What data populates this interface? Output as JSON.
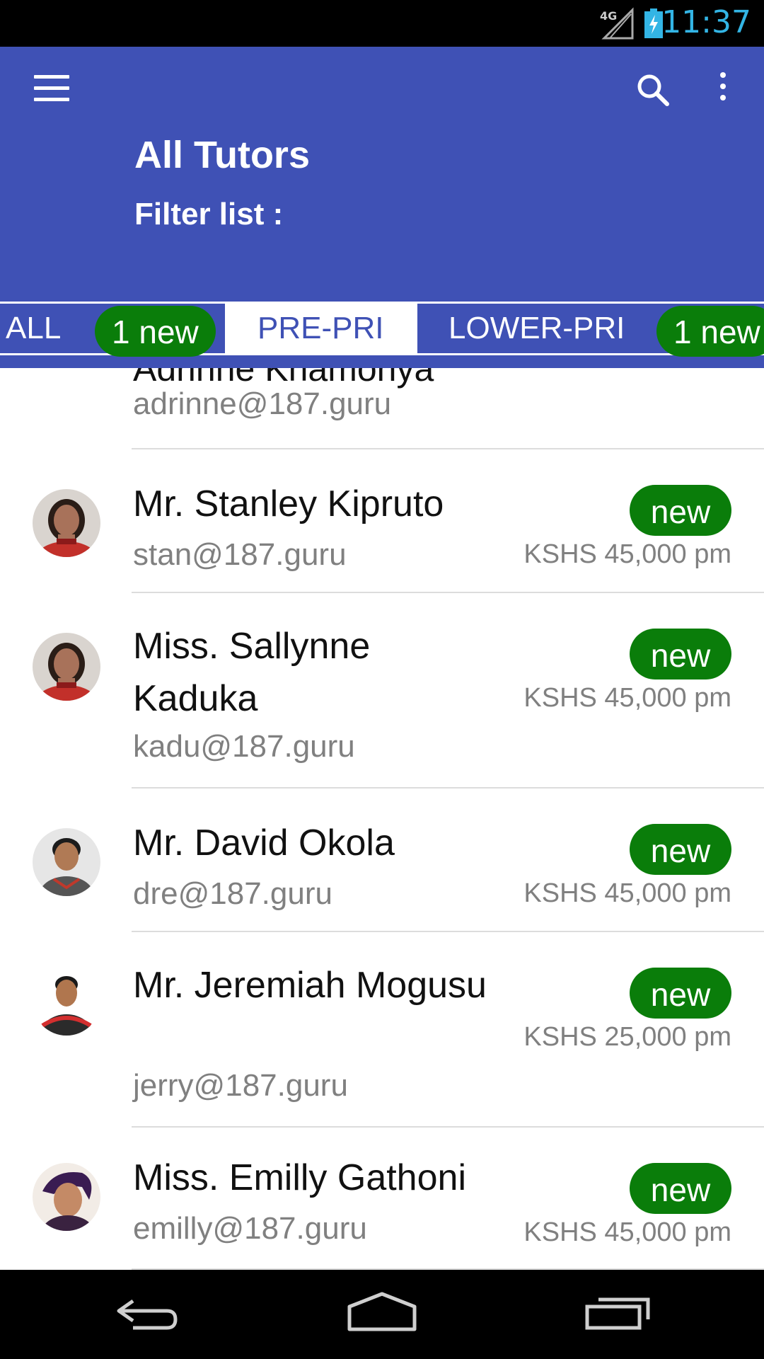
{
  "status_bar": {
    "network": "4G",
    "time": "11:37",
    "clock_color": "#33b5e5"
  },
  "app_bar": {
    "title": "All Tutors",
    "filter_label": "Filter list :",
    "background": "#3f51b5"
  },
  "tabs": [
    {
      "label": "ALL",
      "badge": "1 new",
      "active": false
    },
    {
      "label": "PRE-PRI",
      "badge": "",
      "active": true
    },
    {
      "label": "LOWER-PRI",
      "badge": "1 new",
      "active": false
    }
  ],
  "partial_row": {
    "name": "Adrinne Khamonya",
    "email": "adrinne@187.guru"
  },
  "tutors": [
    {
      "name": "Mr. Stanley Kipruto",
      "email": "stan@187.guru",
      "badge": "new",
      "price": "KSHS 45,000 pm"
    },
    {
      "name": "Miss. Sallynne Kaduka",
      "email": "kadu@187.guru",
      "badge": "new",
      "price": "KSHS 45,000 pm"
    },
    {
      "name": "Mr. David Okola",
      "email": "dre@187.guru",
      "badge": "new",
      "price": "KSHS 45,000 pm"
    },
    {
      "name": "Mr. Jeremiah Mogusu",
      "email": "jerry@187.guru",
      "badge": "new",
      "price": "KSHS 25,000 pm"
    },
    {
      "name": "Miss. Emilly Gathoni",
      "email": "emilly@187.guru",
      "badge": "new",
      "price": "KSHS 45,000 pm"
    }
  ],
  "colors": {
    "badge_green": "#0a7d0a",
    "secondary_text": "#808080"
  }
}
